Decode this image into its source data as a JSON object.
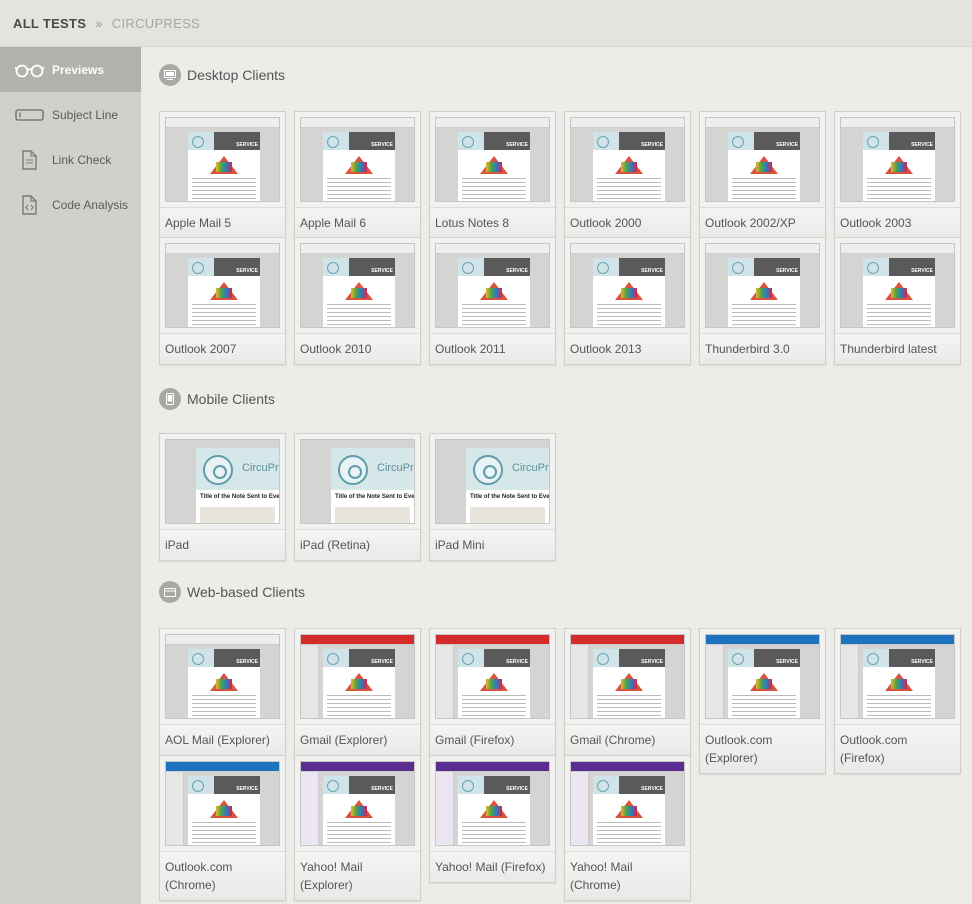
{
  "breadcrumb": {
    "root": "ALL TESTS",
    "separator": "»",
    "current": "CIRCUPRESS"
  },
  "sidebar": {
    "items": [
      {
        "label": "Previews",
        "icon": "glasses-icon",
        "active": true
      },
      {
        "label": "Subject Line",
        "icon": "subject-line-icon",
        "active": false
      },
      {
        "label": "Link Check",
        "icon": "document-icon",
        "active": false
      },
      {
        "label": "Code Analysis",
        "icon": "code-document-icon",
        "active": false
      }
    ]
  },
  "sections": {
    "desktop": {
      "title": "Desktop Clients",
      "icon": "desktop-icon",
      "clients": [
        "Apple Mail 5",
        "Apple Mail 6",
        "Lotus Notes 8",
        "Outlook 2000",
        "Outlook 2002/XP",
        "Outlook 2003",
        "Outlook 2007",
        "Outlook 2010",
        "Outlook 2011",
        "Outlook 2013",
        "Thunderbird 3.0",
        "Thunderbird latest"
      ]
    },
    "mobile": {
      "title": "Mobile Clients",
      "icon": "mobile-icon",
      "clients": [
        "iPad",
        "iPad (Retina)",
        "iPad Mini"
      ],
      "preview_brand": "CircuPre",
      "preview_title": "Title of the Note Sent to Everyon"
    },
    "web": {
      "title": "Web-based Clients",
      "icon": "browser-icon",
      "clients": [
        "AOL Mail (Explorer)",
        "Gmail (Explorer)",
        "Gmail (Firefox)",
        "Gmail (Chrome)",
        "Outlook.com (Explorer)",
        "Outlook.com (Firefox)",
        "Outlook.com (Chrome)",
        "Yahoo! Mail (Explorer)",
        "Yahoo! Mail (Firefox)",
        "Yahoo! Mail (Chrome)"
      ]
    }
  },
  "thumbnail_service_text": "SERVICE",
  "colors": {
    "sidebar_bg": "#d2d0cb",
    "sidebar_active": "#b3b1ab",
    "main_bg": "#ecece9",
    "outlook_blue": "#1e73be",
    "yahoo_purple": "#5c2d91",
    "gmail_red": "#d42b2b"
  }
}
